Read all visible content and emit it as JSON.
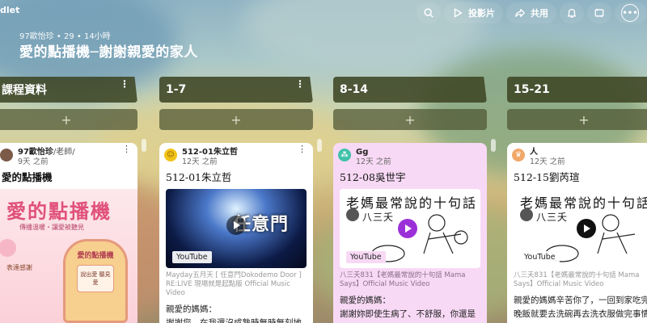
{
  "header": {
    "brand": "dlet",
    "actions": {
      "slideshow": "投影片",
      "share": "共用"
    }
  },
  "board": {
    "meta": "97歐怡珍 • 29 • 14小時",
    "title": "愛的點播機─謝謝親愛的家人"
  },
  "columns": [
    {
      "title": "課程資料"
    },
    {
      "title": "1-7"
    },
    {
      "title": "8-14"
    },
    {
      "title": "15-21"
    }
  ],
  "cards": [
    {
      "author": "97歐怡珍",
      "role": "/老師/",
      "time": "9天 之前",
      "title": "愛的點播機",
      "poster_title": "愛的點播機",
      "poster_subtitle": "傳播溫暖・讓愛被聽見",
      "poster_inner": "愛的點播機",
      "poster_card": "說出愛 聽見愛",
      "poster_bullet": "表達感謝",
      "avatar_color": "#7b5a48"
    },
    {
      "author": "512-01朱立哲",
      "time": "12天 之前",
      "title": "512-01朱立哲",
      "thumb_tag": "YouTube",
      "thumb_text": "任意門",
      "sub": "Mayday五月天 [ 任意門Dokodemo Door ]",
      "sub2": "RE:LIVE 現場就是起點版 Official Music Video",
      "body1": "親愛的媽媽：",
      "body2": "謝謝您，在我還沒成熟時無時無刻地",
      "avatar_color": "#f2c318"
    },
    {
      "author": "Gg",
      "time": "12天 之前",
      "title": "512-08吳世宇",
      "thumb_tag": "YouTube",
      "thumb_title": "老媽最常說的十句話",
      "thumb_sub": "八三夭",
      "sub": "八三夭831【老媽最常說的十句話 Mama",
      "sub2": "Says】Official Music Video",
      "body1": "親愛的媽媽：",
      "body2": "謝謝妳即使生病了、不舒服，你還是",
      "avatar_color": "#3fc1a8"
    },
    {
      "author": "人",
      "time": "12天 之前",
      "title": "512-15劉芮瑄",
      "thumb_tag": "YouTube",
      "thumb_title": "老媽最常說的十句話",
      "thumb_sub": "八三夭",
      "sub": "八三夭831【老媽最常說的十句話 Mama",
      "sub2": "Says】Official Music Video",
      "body1": "親愛的媽媽辛苦你了，一回到家吃完",
      "body2": "晚飯就要去洗碗再去洗衣服做完事情",
      "avatar_color": "#f1a86a"
    }
  ],
  "colors": {
    "column_header": "#3e4624",
    "card_pink": "#f8d9f5",
    "play_purple": "#9b30d9"
  }
}
